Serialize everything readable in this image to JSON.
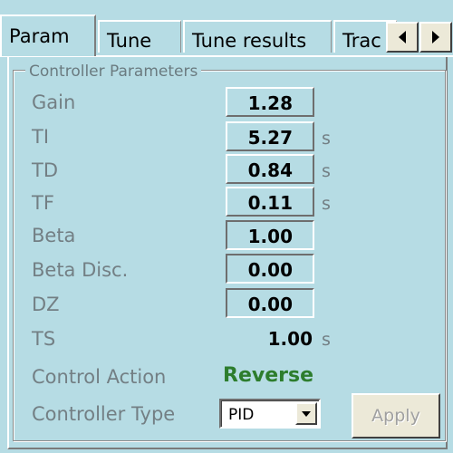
{
  "tabs": [
    {
      "label": "Param",
      "active": true
    },
    {
      "label": "Tune",
      "active": false
    },
    {
      "label": "Tune results",
      "active": false
    },
    {
      "label": "Trac",
      "active": false
    }
  ],
  "tab_scroll": {
    "left_icon": "arrow-left-icon",
    "right_icon": "arrow-right-icon"
  },
  "group": {
    "title": "Controller Parameters"
  },
  "params": [
    {
      "label": "Gain",
      "value": "1.28",
      "unit": ""
    },
    {
      "label": "TI",
      "value": "5.27",
      "unit": "s"
    },
    {
      "label": "TD",
      "value": "0.84",
      "unit": "s"
    },
    {
      "label": "TF",
      "value": "0.11",
      "unit": "s"
    },
    {
      "label": "Beta",
      "value": "1.00",
      "unit": ""
    },
    {
      "label": "Beta Disc.",
      "value": "0.00",
      "unit": ""
    },
    {
      "label": "DZ",
      "value": "0.00",
      "unit": ""
    },
    {
      "label": "TS",
      "value": "1.00",
      "unit": "s"
    }
  ],
  "control_action": {
    "label": "Control Action",
    "value": "Reverse",
    "color": "#2d7d2d"
  },
  "controller_type": {
    "label": "Controller Type",
    "selected": "PID"
  },
  "apply_button": {
    "label": "Apply",
    "enabled": false
  },
  "colors": {
    "background": "#b6dce4",
    "label": "#737f84"
  }
}
